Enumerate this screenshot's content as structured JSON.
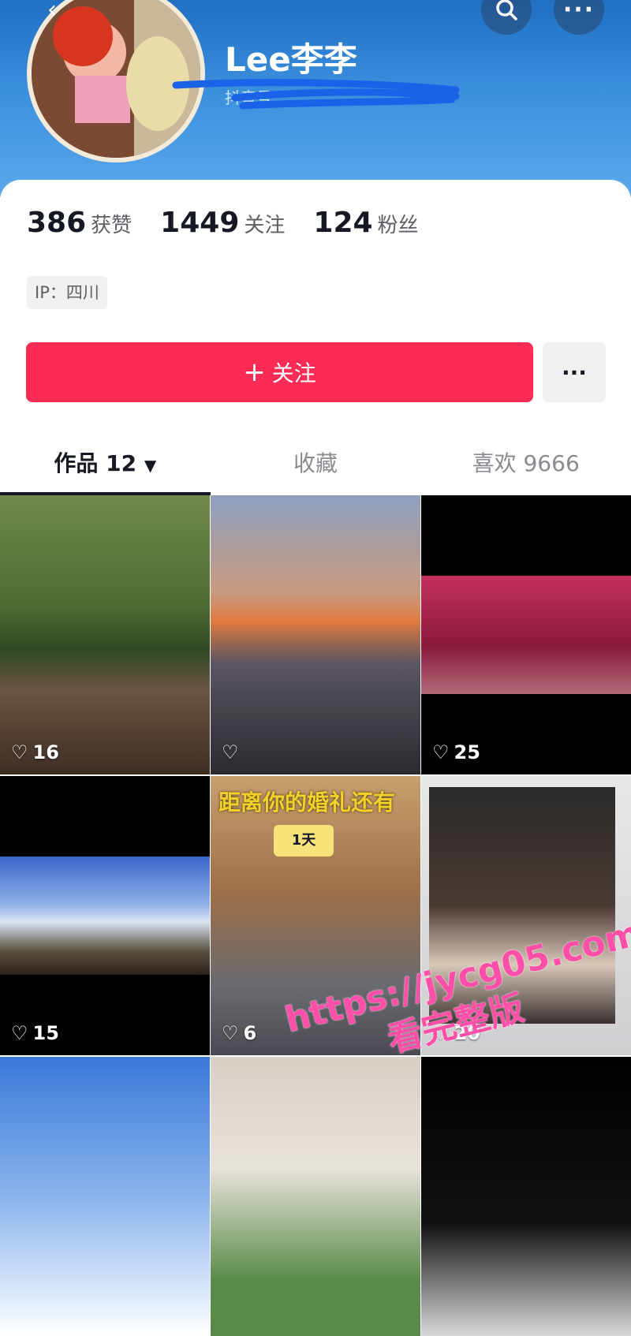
{
  "header": {
    "back_icon": "chevron-left-icon",
    "search_icon": "search-icon",
    "more_icon": "more-dots-icon",
    "username": "Lee李李",
    "handle": "抖音号"
  },
  "stats": [
    {
      "num": "386",
      "label": "获赞"
    },
    {
      "num": "1449",
      "label": "关注"
    },
    {
      "num": "124",
      "label": "粉丝"
    }
  ],
  "ip": "IP：四川",
  "follow_button": {
    "icon": "plus-icon",
    "label": "关注"
  },
  "more_button": "···",
  "tabs": [
    "作品 12",
    "收藏",
    "喜欢 9666"
  ],
  "videos": [
    {
      "likes": "16"
    },
    {
      "likes": ""
    },
    {
      "likes": "25"
    },
    {
      "likes": "15"
    },
    {
      "likes": "6",
      "overlay_text": "距离你的婚礼还有",
      "badge": "1天"
    },
    {
      "likes": "20"
    },
    {
      "likes": ""
    },
    {
      "likes": ""
    },
    {
      "likes": ""
    }
  ],
  "watermark": [
    "https://jycg05.com",
    "看完整版"
  ],
  "colors": {
    "accent": "#fe2c55",
    "header_blue": "#2f7fd0"
  }
}
